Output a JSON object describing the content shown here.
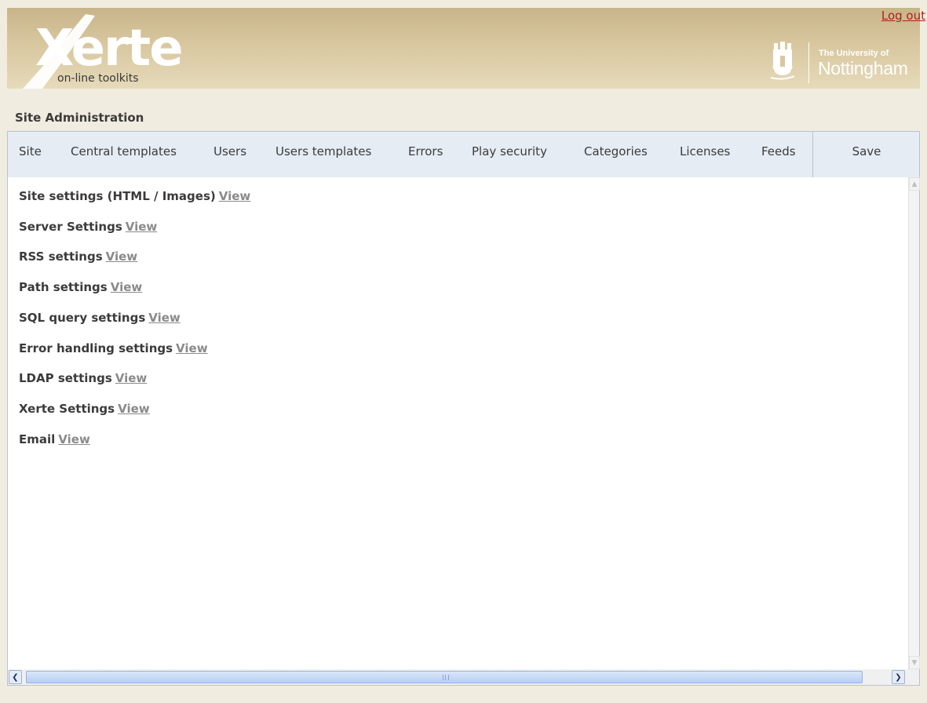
{
  "header": {
    "logo_text": "Xerte",
    "logo_subtitle": "on-line toolkits",
    "logout_label": "Log out",
    "university_line1": "The University of",
    "university_line2": "Nottingham"
  },
  "page": {
    "title": "Site Administration"
  },
  "tabs": [
    {
      "label": "Site"
    },
    {
      "label": "Central templates"
    },
    {
      "label": "Users"
    },
    {
      "label": "Users templates"
    },
    {
      "label": "Errors"
    },
    {
      "label": "Play security"
    },
    {
      "label": "Categories"
    },
    {
      "label": "Licenses"
    },
    {
      "label": "Feeds"
    }
  ],
  "save_label": "Save",
  "settings": [
    {
      "label": "Site settings (HTML / Images)",
      "link": "View"
    },
    {
      "label": "Server Settings",
      "link": "View"
    },
    {
      "label": "RSS settings",
      "link": "View"
    },
    {
      "label": "Path settings",
      "link": "View"
    },
    {
      "label": "SQL query settings",
      "link": "View"
    },
    {
      "label": "Error handling settings",
      "link": "View"
    },
    {
      "label": "LDAP settings",
      "link": "View"
    },
    {
      "label": "Xerte Settings",
      "link": "View"
    },
    {
      "label": "Email",
      "link": "View"
    }
  ],
  "colors": {
    "banner": "#d8c79f",
    "logout": "#b0201a",
    "tabbar": "#e6ecf4",
    "page_bg": "#f1ece0",
    "link": "#8a8a8a"
  }
}
